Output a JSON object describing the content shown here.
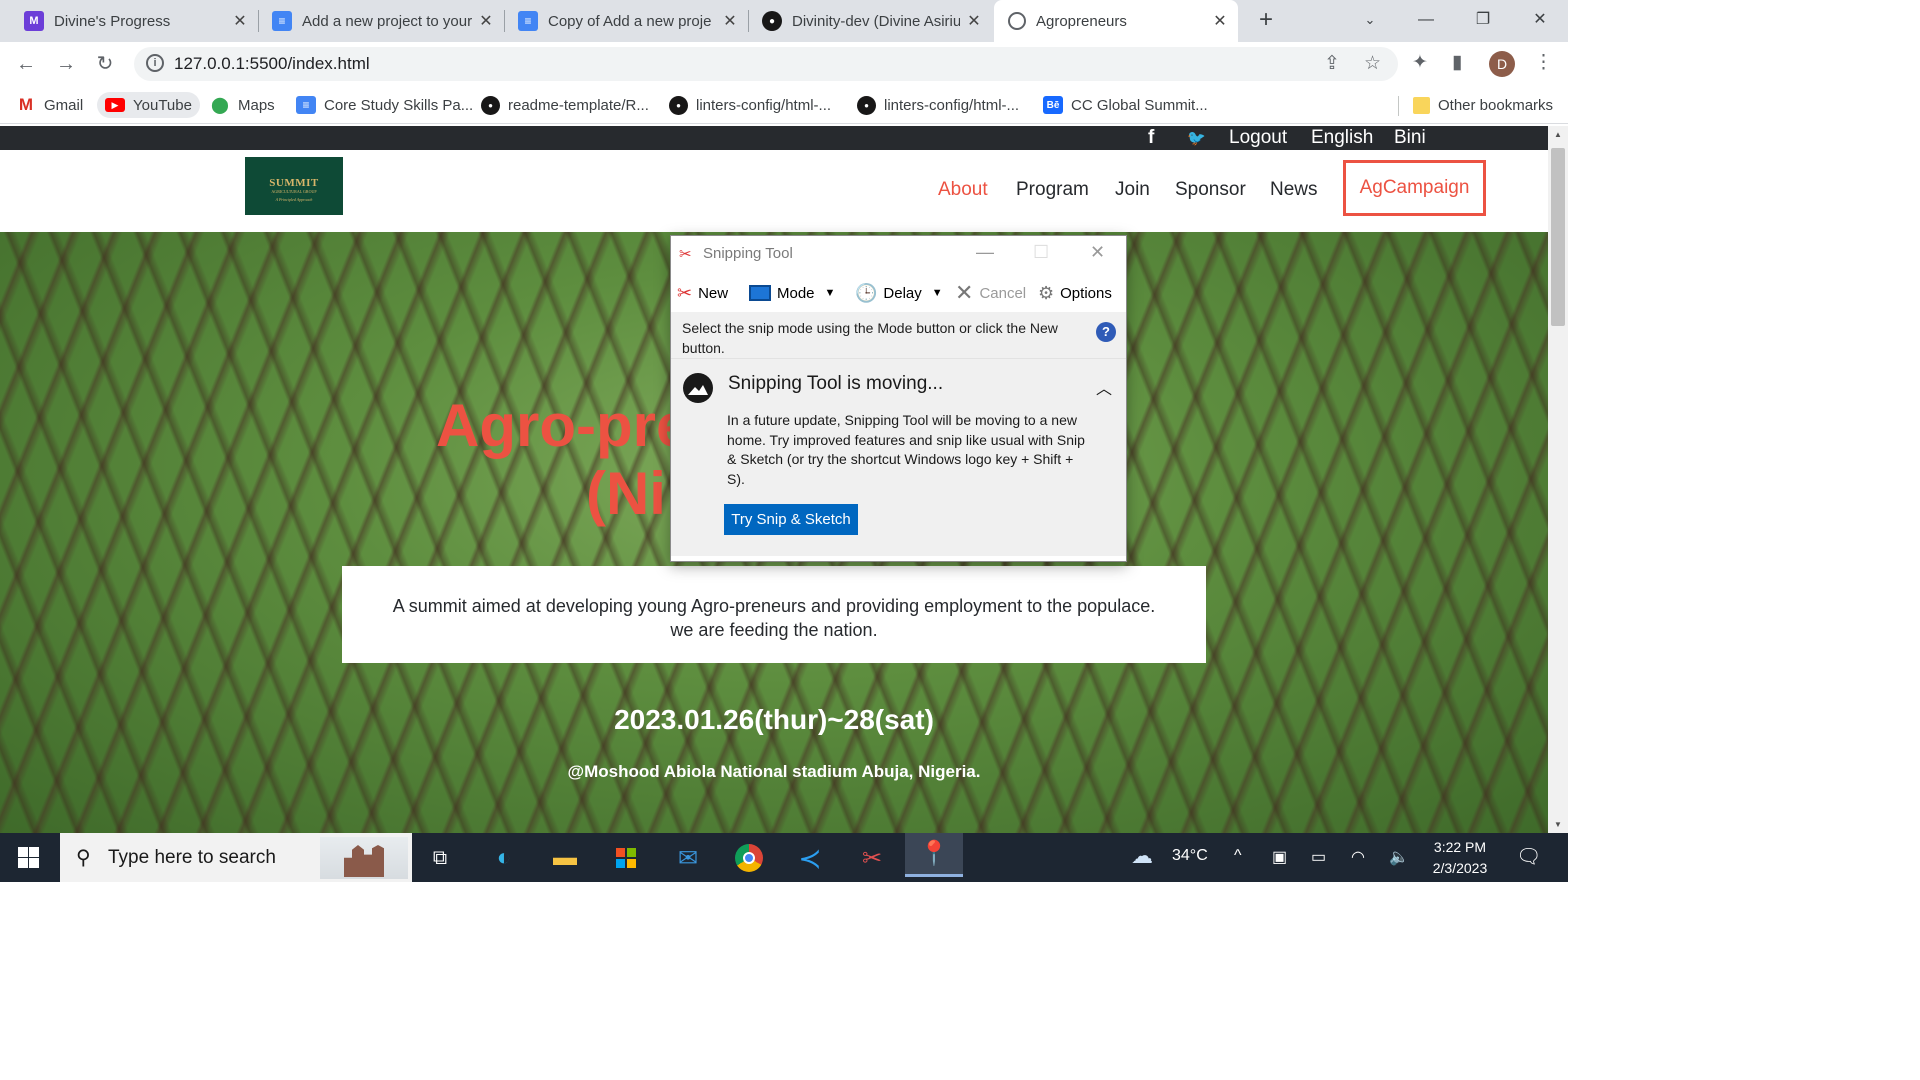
{
  "browser": {
    "tabs": [
      {
        "title": "Divine's Progress",
        "icon": "microverse-icon",
        "color": "#6c3ed8"
      },
      {
        "title": "Add a new project to your",
        "icon": "docs-icon",
        "color": "#4285f4"
      },
      {
        "title": "Copy of Add a new proje",
        "icon": "docs-icon",
        "color": "#4285f4"
      },
      {
        "title": "Divinity-dev (Divine Asiriu",
        "icon": "github-icon",
        "color": "#181717"
      },
      {
        "title": "Agropreneurs",
        "icon": "globe-icon",
        "color": "#5f6368"
      }
    ],
    "url": "127.0.0.1:5500/index.html",
    "profile_initial": "D",
    "bookmarks": [
      {
        "label": "Gmail",
        "icon": "gmail-icon"
      },
      {
        "label": "YouTube",
        "icon": "youtube-icon"
      },
      {
        "label": "Maps",
        "icon": "maps-icon"
      },
      {
        "label": "Core Study Skills Pa...",
        "icon": "docs-icon"
      },
      {
        "label": "readme-template/R...",
        "icon": "github-icon"
      },
      {
        "label": "linters-config/html-...",
        "icon": "github-icon"
      },
      {
        "label": "linters-config/html-...",
        "icon": "github-icon"
      },
      {
        "label": "CC Global Summit...",
        "icon": "behance-icon"
      }
    ],
    "other_bookmarks": "Other bookmarks"
  },
  "site": {
    "topbar": {
      "logout": "Logout",
      "language": "English",
      "user": "Bini",
      "facebook": "f"
    },
    "logo": {
      "name": "SUMMIT",
      "sub": "AGRICULTURAL GROUP",
      "tagline": "A Principled Approach"
    },
    "nav": [
      "About",
      "Program",
      "Join",
      "Sponsor",
      "News"
    ],
    "cta": "AgCampaign",
    "accent": "#ec5242",
    "hero": {
      "title_line1": "Agro-pre",
      "title_line2": "(Ni",
      "description": "A summit aimed at developing young Agro-preneurs and providing employment to the populace.",
      "description2": "we are feeding the nation.",
      "date": "2023.01.26(thur)~28(sat)",
      "venue": "@Moshood Abiola National stadium Abuja, Nigeria."
    }
  },
  "snipping_tool": {
    "title": "Snipping Tool",
    "toolbar": {
      "new": "New",
      "mode": "Mode",
      "delay": "Delay",
      "cancel": "Cancel",
      "options": "Options"
    },
    "instruction": "Select the snip mode using the Mode button or click the New button.",
    "notice_title": "Snipping Tool is moving...",
    "notice_body": "In a future update, Snipping Tool will be moving to a new home. Try improved features and snip like usual with Snip & Sketch (or try the shortcut Windows logo key + Shift + S).",
    "notice_button": "Try Snip & Sketch"
  },
  "taskbar": {
    "search_placeholder": "Type here to search",
    "temperature": "34°C",
    "time": "3:22 PM",
    "date": "2/3/2023"
  }
}
